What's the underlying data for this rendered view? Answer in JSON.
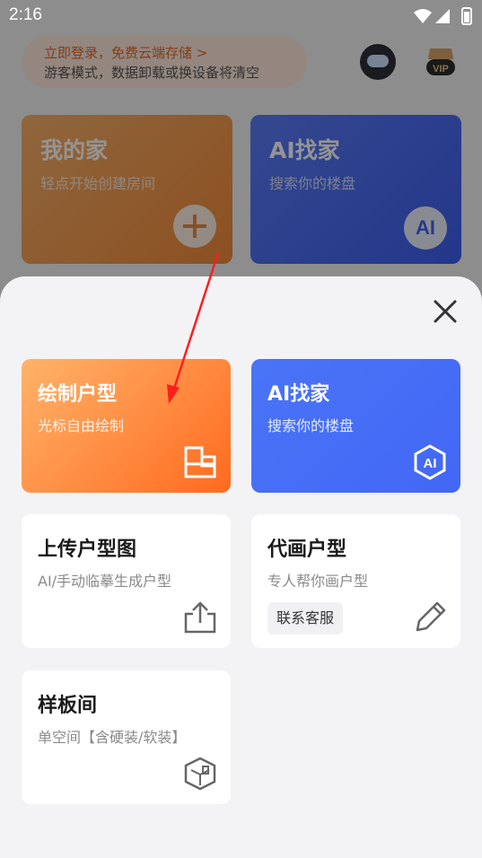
{
  "status_bar": {
    "time": "2:16"
  },
  "background": {
    "login_line1": "立即登录，免费云端存储 >",
    "login_line2": "游客模式，数据卸载或换设备将清空",
    "vip_label": "VIP",
    "card_home": {
      "title": "我的家",
      "subtitle": "轻点开始创建房间"
    },
    "card_ai": {
      "title": "AI找家",
      "subtitle": "搜索你的楼盘",
      "badge": "AI"
    }
  },
  "sheet": {
    "tiles": [
      {
        "title": "绘制户型",
        "subtitle": "光标自由绘制",
        "icon": "floorplan-draw-icon"
      },
      {
        "title": "AI找家",
        "subtitle": "搜索你的楼盘",
        "icon": "ai-hexagon-icon",
        "icon_text": "AI"
      },
      {
        "title": "上传户型图",
        "subtitle": "AI/手动临摹生成户型",
        "icon": "upload-icon"
      },
      {
        "title": "代画户型",
        "subtitle": "专人帮你画户型",
        "chip": "联系客服",
        "icon": "pencil-icon"
      },
      {
        "title": "样板间",
        "subtitle": "单空间【含硬装/软装】",
        "icon": "cube-room-icon"
      }
    ]
  },
  "colors": {
    "orange_start": "#ffb36a",
    "orange_end": "#ff6a1e",
    "blue": "#4a74f7",
    "annotation_arrow": "#ff1e1e"
  }
}
